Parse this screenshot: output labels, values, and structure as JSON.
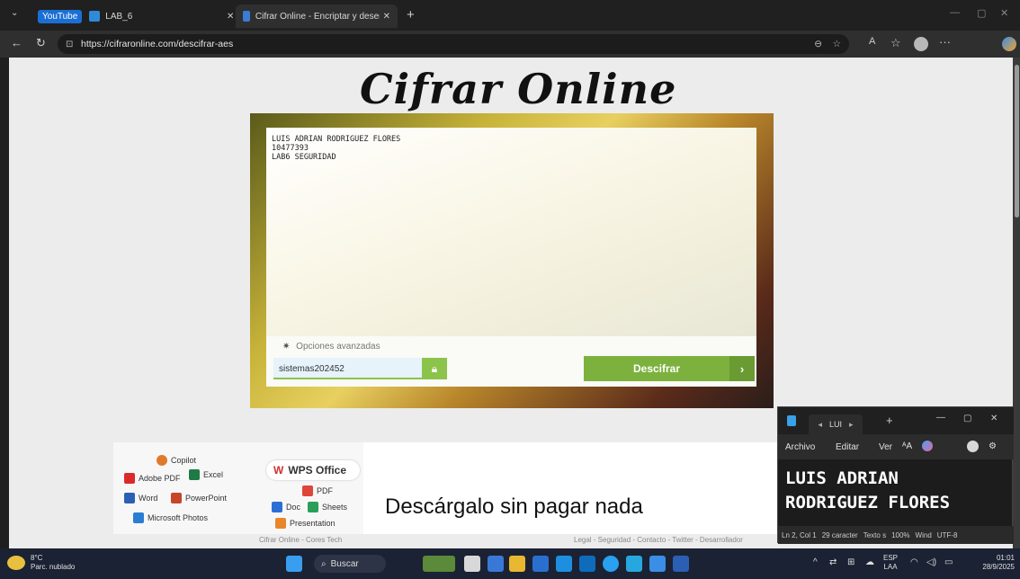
{
  "browser": {
    "tabs": [
      {
        "label": "YouTube"
      },
      {
        "label": "LAB_6"
      },
      {
        "label": "Cifrar Online - Encriptar y desenc"
      }
    ],
    "url": "https://cifraronline.com/descifrar-aes"
  },
  "page": {
    "logo": "Cifrar Online",
    "textarea_value": "LUIS ADRIAN RODRIGUEZ FLORES\n10477393\nLAB6 SEGURIDAD",
    "advanced_options": "Opciones avanzadas",
    "key_value": "sistemas202452",
    "decrypt_label": "Descifrar",
    "footer_left": "Cifrar Online - Cores Tech",
    "footer_links": "Legal - Seguridad - Contacto - Twitter - Desarrollador"
  },
  "ad": {
    "copilot": "Copilot",
    "adobe": "Adobe PDF",
    "excel": "Excel",
    "word": "Word",
    "powerpoint": "PowerPoint",
    "photos": "Microsoft Photos",
    "wps": "WPS Office",
    "pdf": "PDF",
    "doc": "Doc",
    "sheets": "Sheets",
    "presentation": "Presentation",
    "headline": "Descárgalo sin pagar nada"
  },
  "notepad": {
    "tab": "LUI",
    "menu": [
      "Archivo",
      "Editar",
      "Ver"
    ],
    "text": "LUIS ADRIAN\nRODRIGUEZ FLORES",
    "status": [
      "Ln 2, Col 1",
      "29 caracter",
      "Texto s",
      "100%",
      "Wind",
      "UTF-8"
    ]
  },
  "taskbar": {
    "weather_temp": "8°C",
    "weather_desc": "Parc. nublado",
    "search": "Buscar",
    "lang": "ESP",
    "lang2": "LAA",
    "time": "01:01",
    "date": "28/9/2025"
  }
}
